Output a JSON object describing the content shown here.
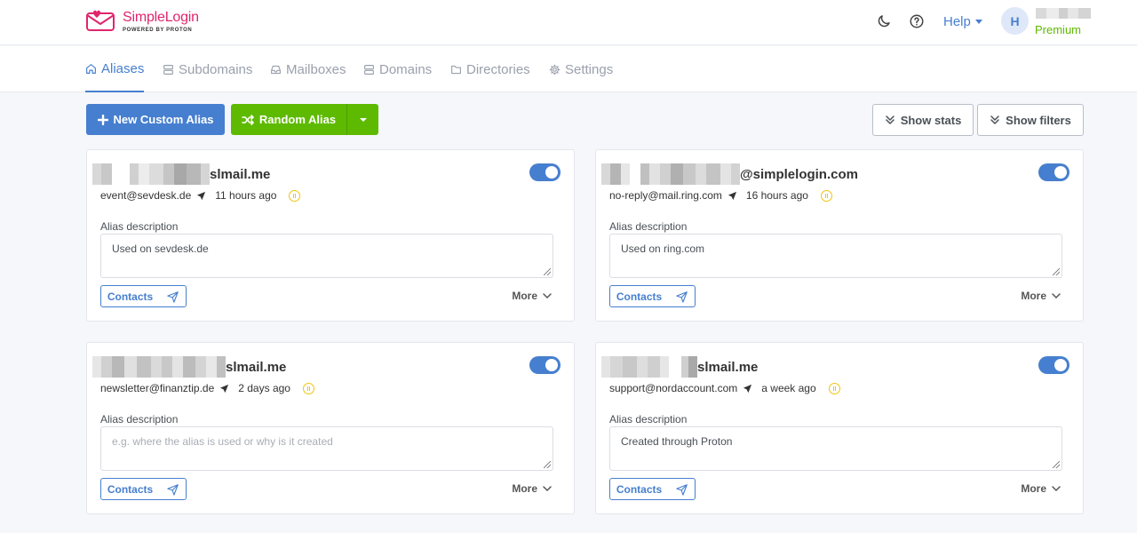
{
  "app": {
    "logo_name": "SimpleLogin",
    "logo_sub": "POWERED BY PROTON",
    "brand_color": "#e0256d",
    "accent_color": "#467fcf",
    "success_color": "#5eba00"
  },
  "header": {
    "dark_mode_icon": "moon-icon",
    "docs_icon": "question-circle-icon",
    "help_label": "Help",
    "avatar_initial": "H",
    "plan_label": "Premium"
  },
  "nav": {
    "tabs": [
      {
        "label": "Aliases",
        "icon": "home-icon",
        "active": true
      },
      {
        "label": "Subdomains",
        "icon": "server-icon",
        "active": false
      },
      {
        "label": "Mailboxes",
        "icon": "inbox-icon",
        "active": false
      },
      {
        "label": "Domains",
        "icon": "server-icon",
        "active": false
      },
      {
        "label": "Directories",
        "icon": "folder-icon",
        "active": false
      },
      {
        "label": "Settings",
        "icon": "gear-icon",
        "active": false
      }
    ]
  },
  "toolbar": {
    "new_alias_label": "New Custom Alias",
    "random_alias_label": "Random Alias",
    "show_stats_label": "Show stats",
    "show_filters_label": "Show filters"
  },
  "aliases": [
    {
      "email_suffix": "slmail.me",
      "enabled": true,
      "contact": "event@sevdesk.de",
      "time": "11 hours ago",
      "description_label": "Alias description",
      "description": "Used on sevdesk.de",
      "contacts_label": "Contacts",
      "more_label": "More"
    },
    {
      "email_suffix": "@simplelogin.com",
      "enabled": true,
      "contact": "no-reply@mail.ring.com",
      "time": "16 hours ago",
      "description_label": "Alias description",
      "description": "Used on ring.com",
      "contacts_label": "Contacts",
      "more_label": "More"
    },
    {
      "email_suffix": "slmail.me",
      "enabled": true,
      "contact": "newsletter@finanztip.de",
      "time": "2 days ago",
      "description_label": "Alias description",
      "description_placeholder": "e.g. where the alias is used or why is it created",
      "contacts_label": "Contacts",
      "more_label": "More"
    },
    {
      "email_suffix": "slmail.me",
      "enabled": true,
      "contact": "support@nordaccount.com",
      "time": "a week ago",
      "description_label": "Alias description",
      "description": "Created through Proton",
      "contacts_label": "Contacts",
      "more_label": "More"
    }
  ]
}
